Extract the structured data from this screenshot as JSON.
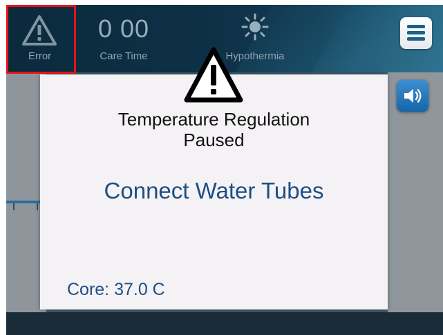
{
  "status_bar": {
    "error": {
      "label": "Error",
      "icon": "warning-icon"
    },
    "care_time": {
      "value": "0 00",
      "label": "Care Time"
    },
    "mode": {
      "label": "Hypothermia",
      "icon": "sun-icon"
    },
    "menu": {
      "icon": "hamburger-menu-icon"
    }
  },
  "sound": {
    "icon": "speaker-icon"
  },
  "dialog": {
    "icon": "warning-icon",
    "title_line1": "Temperature Regulation",
    "title_line2": "Paused",
    "message": "Connect Water Tubes",
    "core_label": "Core: 37.0 C"
  },
  "colors": {
    "highlight": "#e3141b",
    "accent_text": "#1d4e84",
    "status_text": "#8fa5b3",
    "sound_button": "#1565a8"
  }
}
